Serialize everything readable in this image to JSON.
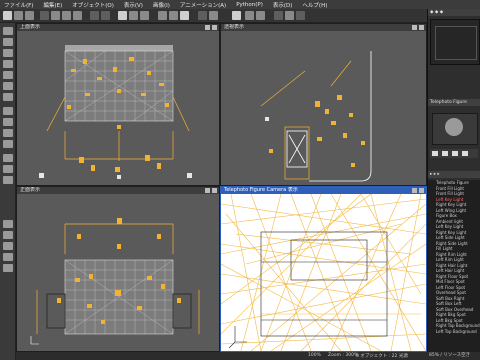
{
  "menu": [
    "ファイル(F)",
    "編集(E)",
    "オブジェクト(O)",
    "表示(V)",
    "画像(I)",
    "アニメーション(A)",
    "Python(P)",
    "表示(D)",
    "ヘルプ(H)"
  ],
  "viewports": {
    "top_left": {
      "title": "上面表示"
    },
    "top_right": {
      "title": "透視表示"
    },
    "bottom_left": {
      "title": "正面表示"
    },
    "bottom_right": {
      "title": "Telephoto Figure Camera 表示"
    }
  },
  "right_panel": {
    "camera_label": "Telephoto Figure",
    "scene_items": [
      "Telephoto Figure",
      "Front Fill Light",
      "Front Fill Light",
      "Left Key Light",
      "Right Key Light",
      "Left Wing Light",
      "Figure Box",
      "Ambient light",
      "Left Key Light",
      "Right Key Light",
      "Left Side Light",
      "Right Side Light",
      "Fill Light",
      "Right Rim Light",
      "Left Rim Light",
      "Right Hair Light",
      "Left Hair Light",
      "Right Floor Spot",
      "Mid Floor Spot",
      "Left Floor Spot",
      "Overhead Spot",
      "Soft Box Right",
      "Soft Box Left",
      "Soft Box Overhead",
      "Right Bkg Spot",
      "Left Bkg Spot",
      "Right Top Background",
      "Left Top Background"
    ],
    "selected_index": 3
  },
  "status": {
    "fps": "100%",
    "zoom": "Zoom : 300%",
    "objects": "0 オブジェクト : 22 光源",
    "progress": "85% / リソース空き"
  },
  "colors": {
    "light": "#f2b233",
    "wire": "#ffffff",
    "viewport_bg": "#5a5a5a",
    "active_header": "#2f5fb8"
  }
}
